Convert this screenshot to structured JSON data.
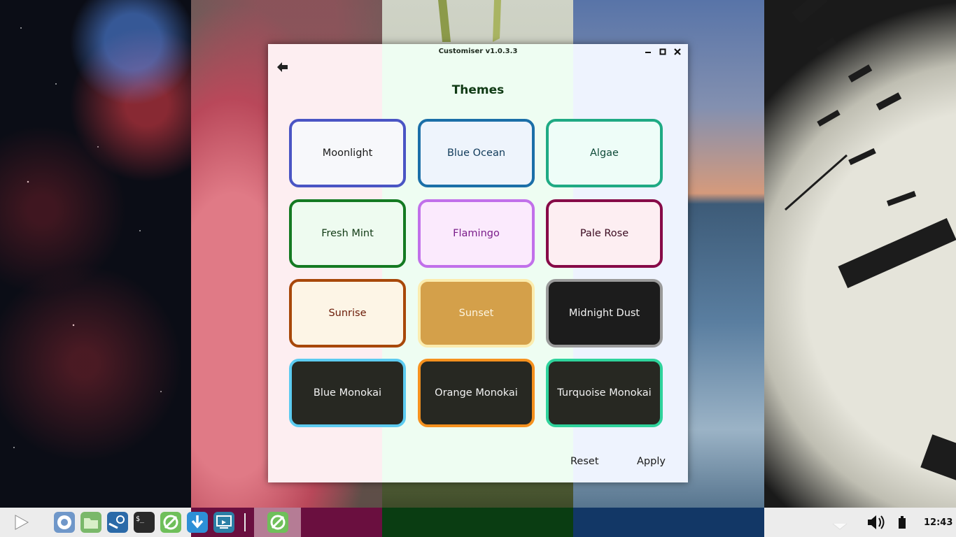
{
  "window": {
    "title": "Customiser v1.0.3.3",
    "minimize_icon": "minimize-icon",
    "maximize_icon": "maximize-icon",
    "close_icon": "close-icon",
    "back_icon": "arrow-left-icon"
  },
  "page": {
    "heading": "Themes"
  },
  "themes": [
    {
      "name": "Moonlight",
      "border": "#4a55c4",
      "bg": "#f7f8fb",
      "text": "#1a1a1a"
    },
    {
      "name": "Blue Ocean",
      "border": "#1b6fa8",
      "bg": "#eef4fc",
      "text": "#103a5a"
    },
    {
      "name": "Algae",
      "border": "#1faa84",
      "bg": "#eefdf8",
      "text": "#0e4a38"
    },
    {
      "name": "Fresh Mint",
      "border": "#147a22",
      "bg": "#eefbf0",
      "text": "#103a14"
    },
    {
      "name": "Flamingo",
      "border": "#c170ea",
      "bg": "#fbeafd",
      "text": "#7a1d8a"
    },
    {
      "name": "Pale Rose",
      "border": "#870a48",
      "bg": "#fdeef2",
      "text": "#3a0a20"
    },
    {
      "name": "Sunrise",
      "border": "#a8480a",
      "bg": "#fdf5e6",
      "text": "#6a1a06"
    },
    {
      "name": "Sunset",
      "border": "#fbecae",
      "bg": "#d4a04a",
      "text": "#fdf5e0"
    },
    {
      "name": "Midnight Dust",
      "border": "#9a9a9a",
      "bg": "#1c1c1c",
      "text": "#f2f2f2"
    },
    {
      "name": "Blue Monokai",
      "border": "#5ccbf0",
      "bg": "#272822",
      "text": "#f2f2f2"
    },
    {
      "name": "Orange Monokai",
      "border": "#f6911e",
      "bg": "#272822",
      "text": "#f2f2f2"
    },
    {
      "name": "Turquoise Monokai",
      "border": "#2fd39c",
      "bg": "#272822",
      "text": "#f2f2f2"
    }
  ],
  "footer": {
    "reset_label": "Reset",
    "apply_label": "Apply"
  },
  "taskbar": {
    "icons": [
      "start-icon",
      "chromium-icon",
      "file-manager-icon",
      "steam-icon",
      "terminal-icon",
      "customiser-icon",
      "downloader-icon",
      "remote-desktop-icon"
    ],
    "active_app_icon": "customiser-icon",
    "tray_icons": [
      "tray-chevron-icon",
      "volume-icon",
      "battery-icon"
    ],
    "clock": "12:43"
  }
}
